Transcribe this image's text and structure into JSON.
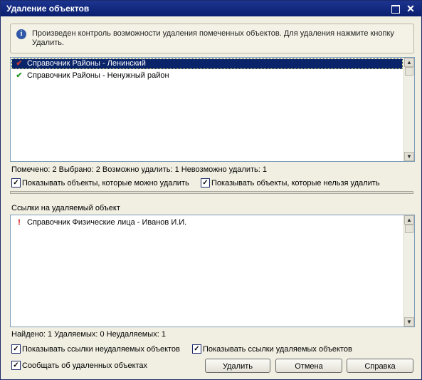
{
  "window": {
    "title": "Удаление объектов"
  },
  "info": {
    "text": "Произведен контроль возможности удаления помеченных объектов. Для удаления нажмите кнопку Удалить.",
    "icon": "info-icon"
  },
  "objects": [
    {
      "label": "Справочник Районы - Ленинский",
      "icon": "red-check-icon",
      "selected": true
    },
    {
      "label": "Справочник Районы - Ненужный район",
      "icon": "green-check-icon",
      "selected": false
    }
  ],
  "objects_stats": "Помечено: 2  Выбрано: 2  Возможно удалить: 1  Невозможно удалить: 1",
  "options": {
    "show_deletable": "Показывать объекты, которые можно удалить",
    "show_undeletable": "Показывать объекты, которые нельзя удалить"
  },
  "references": {
    "label": "Ссылки на удаляемый объект",
    "items": [
      {
        "label": "Справочник Физические лица - Иванов И.И.",
        "icon": "exclamation-icon"
      }
    ],
    "stats": "Найдено: 1  Удаляемых: 0  Неудаляемых: 1",
    "show_undeletable_refs": "Показывать ссылки неудаляемых объектов",
    "show_deletable_refs": "Показывать ссылки удаляемых объектов"
  },
  "notify_deleted": "Сообщать об удаленных объектах",
  "buttons": {
    "delete": "Удалить",
    "cancel": "Отмена",
    "help": "Справка"
  },
  "colors": {
    "title_bar": "#0a1f6e",
    "selection": "#0a246a"
  }
}
